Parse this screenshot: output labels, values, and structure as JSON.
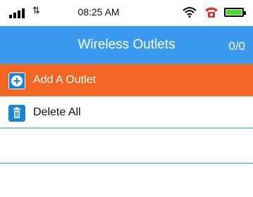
{
  "status_bar": {
    "time": "08:25 AM",
    "data_arrows": "⇅",
    "signal_icon": "signal-bars-icon",
    "wifi_icon": "wifi-icon",
    "alert_icon": "phone-alert-icon",
    "battery_icon": "battery-icon",
    "battery_level": 1.0
  },
  "header": {
    "title": "Wireless Outlets",
    "count": "0/0"
  },
  "menu": {
    "add_label": "Add A Outlet",
    "add_icon": "plus-circle-icon",
    "delete_label": "Delete All",
    "delete_icon": "trash-icon"
  },
  "colors": {
    "header_bg": "#3a9af0",
    "add_row_bg": "#f26522",
    "icon_bg": "#1a86d6",
    "divider": "#8cc4ee",
    "battery_fill": "#44dd22",
    "alert_red": "#e8302c"
  }
}
